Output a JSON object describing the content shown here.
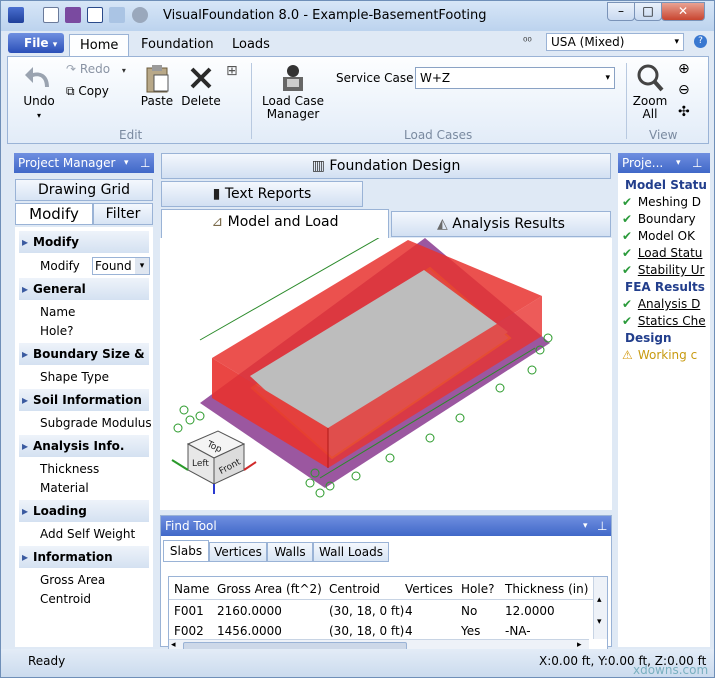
{
  "window": {
    "title": "VisualFoundation 8.0 - Example-BasementFooting",
    "min": "–",
    "max": "□",
    "close": "✕"
  },
  "ribbon": {
    "file_label": "File",
    "tabs": [
      "Home",
      "Foundation",
      "Loads"
    ],
    "units_value": "USA (Mixed)",
    "edit": {
      "undo": "Undo",
      "redo": "Redo",
      "copy": "Copy",
      "paste": "Paste",
      "delete": "Delete",
      "group": "Edit"
    },
    "loadcases": {
      "manager_line1": "Load Case",
      "manager_line2": "Manager",
      "service_case_label": "Service Case",
      "service_case_value": "W+Z",
      "group": "Load Cases"
    },
    "view": {
      "zoom_line1": "Zoom",
      "zoom_line2": "All",
      "group": "View"
    }
  },
  "project_manager": {
    "title": "Project Manager",
    "tabs": {
      "drawing_grid": "Drawing Grid",
      "modify": "Modify",
      "filter": "Filter"
    },
    "sections": {
      "modify": {
        "title": "Modify",
        "row_label": "Modify",
        "row_value": "Found"
      },
      "general": {
        "title": "General",
        "items": [
          "Name",
          "Hole?"
        ]
      },
      "boundary": {
        "title": "Boundary Size & S",
        "items": [
          "Shape Type"
        ]
      },
      "soil": {
        "title": "Soil Information",
        "items": [
          "Subgrade Modulus"
        ]
      },
      "analysis": {
        "title": "Analysis Info.",
        "items": [
          "Thickness",
          "Material"
        ]
      },
      "loading": {
        "title": "Loading",
        "items": [
          "Add Self Weight"
        ]
      },
      "information": {
        "title": "Information",
        "items": [
          "Gross Area",
          "Centroid"
        ]
      }
    }
  },
  "doc_tabs": {
    "foundation_design": "Foundation Design",
    "text_reports": "Text Reports",
    "model_and_load": "Model and Load",
    "analysis_results": "Analysis Results"
  },
  "viewcube": {
    "top": "Top",
    "left": "Left",
    "front": "Front"
  },
  "find_tool": {
    "title": "Find Tool",
    "tabs": [
      "Slabs",
      "Vertices",
      "Walls",
      "Wall Loads"
    ],
    "columns": [
      "Name",
      "Gross Area (ft^2)",
      "Centroid",
      "Vertices",
      "Hole?",
      "Thickness (in)"
    ],
    "rows": [
      [
        "F001",
        "2160.0000",
        "(30, 18, 0 ft)",
        "4",
        "No",
        "12.0000"
      ],
      [
        "F002",
        "1456.0000",
        "(30, 18, 0 ft)",
        "4",
        "Yes",
        "-NA-"
      ]
    ]
  },
  "status_panel": {
    "title": "Proje...",
    "model_status": "Model Statu",
    "items": [
      {
        "icon": "check",
        "text": "Meshing D",
        "link": false
      },
      {
        "icon": "check",
        "text": "Boundary",
        "link": false
      },
      {
        "icon": "check",
        "text": "Model OK",
        "link": false
      },
      {
        "icon": "check",
        "text": "Load Statu",
        "link": true
      },
      {
        "icon": "check",
        "text": "Stability Ur",
        "link": true
      }
    ],
    "fea_results": "FEA Results",
    "fea_items": [
      {
        "icon": "check",
        "text": "Analysis D",
        "link": true
      },
      {
        "icon": "check",
        "text": "Statics Che",
        "link": true
      }
    ],
    "design": "Design",
    "design_items": [
      {
        "icon": "warning",
        "text": "Working c"
      }
    ]
  },
  "statusbar": {
    "left": "Ready",
    "coords": "X:0.00 ft, Y:0.00 ft, Z:0.00 ft"
  },
  "watermark": "xdowns.com",
  "colors": {
    "accent": "#4068c8",
    "wall_red": "#e8322f",
    "slab_purple": "#8a3a8f",
    "ok_green": "#2a9a3a"
  }
}
